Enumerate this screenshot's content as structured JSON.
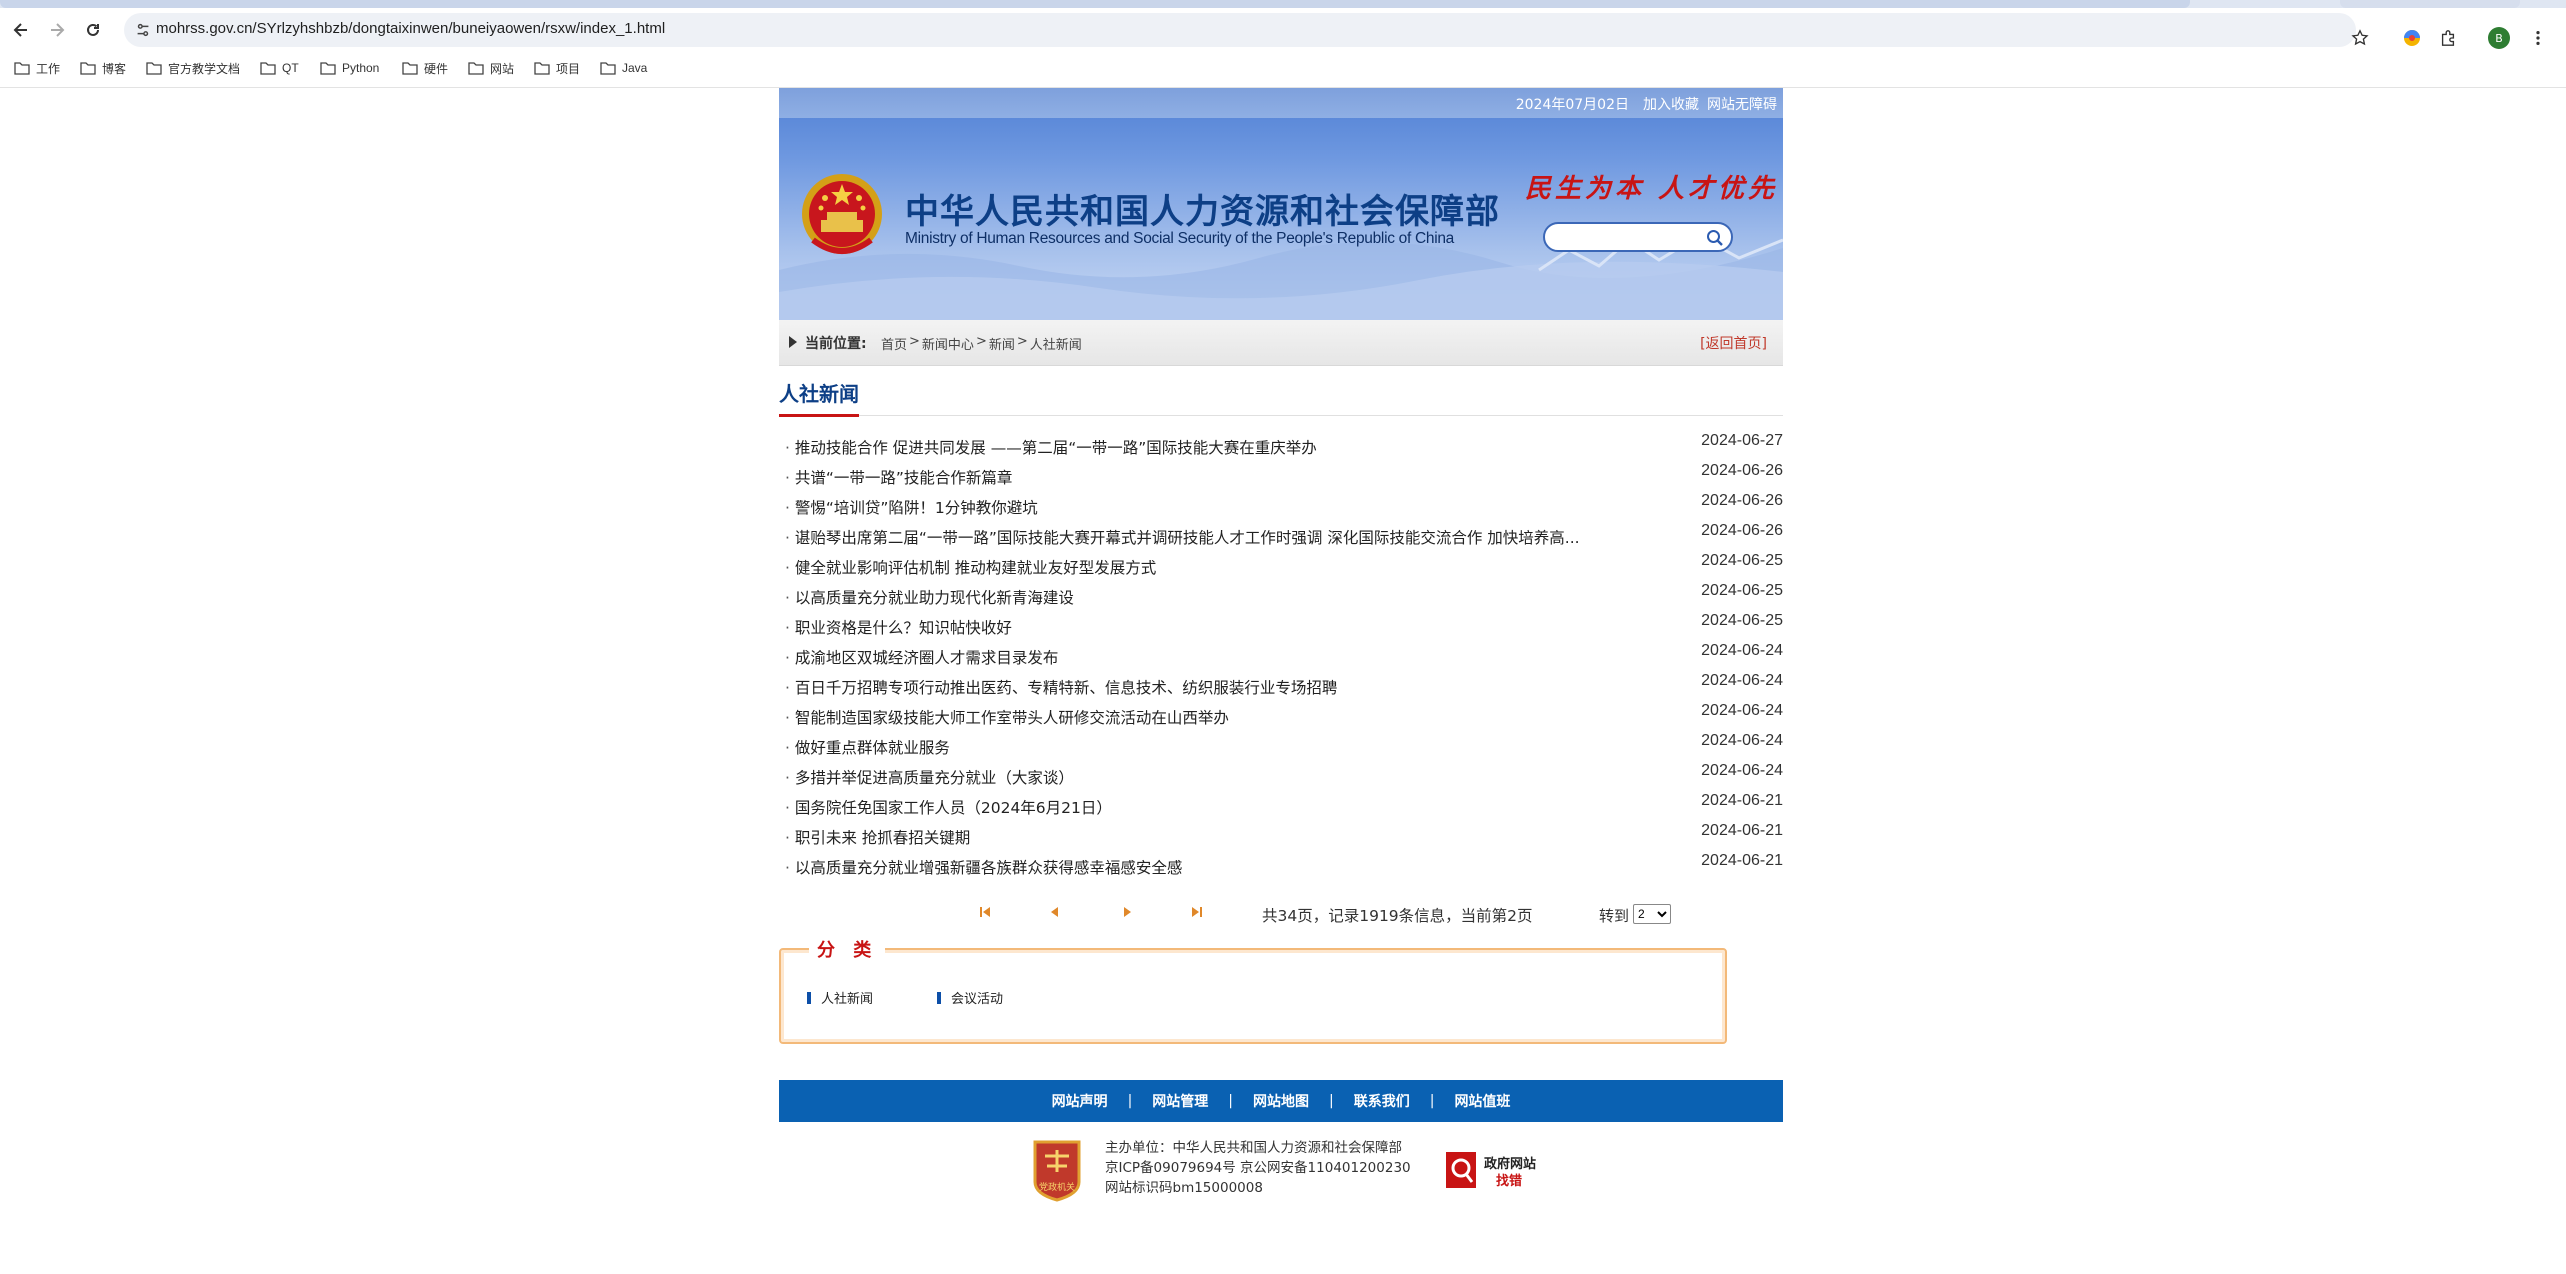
{
  "browser": {
    "url": "mohrss.gov.cn/SYrlzyhshbzb/dongtaixinwen/buneiyaowen/rsxw/index_1.html",
    "profile_initial": "B",
    "bookmarks": [
      "工作",
      "博客",
      "官方教学文档",
      "QT",
      "Python",
      "硬件",
      "网站",
      "项目",
      "Java"
    ]
  },
  "header": {
    "date": "2024年07月02日",
    "add_favorite": "加入收藏",
    "accessibility": "网站无障碍",
    "title_cn": "中华人民共和国人力资源和社会保障部",
    "title_en": "Ministry of Human Resources and Social Security of the People's Republic of China",
    "slogan": "民生为本 人才优先",
    "search_placeholder": ""
  },
  "breadcrumb": {
    "label": "当前位置:",
    "items": [
      "首页",
      "新闻中心",
      "新闻",
      "人社新闻"
    ],
    "separator": ">",
    "back_home": "[返回首页]"
  },
  "section": {
    "title": "人社新闻"
  },
  "news": [
    {
      "title": "推动技能合作 促进共同发展 ——第二届“一带一路”国际技能大赛在重庆举办",
      "date": "2024-06-27"
    },
    {
      "title": "共谱“一带一路”技能合作新篇章",
      "date": "2024-06-26"
    },
    {
      "title": "警惕“培训贷”陷阱！1分钟教你避坑",
      "date": "2024-06-26"
    },
    {
      "title": "谌贻琴出席第二届“一带一路”国际技能大赛开幕式并调研技能人才工作时强调 深化国际技能交流合作 加快培养高...",
      "date": "2024-06-26"
    },
    {
      "title": "健全就业影响评估机制 推动构建就业友好型发展方式",
      "date": "2024-06-25"
    },
    {
      "title": "以高质量充分就业助力现代化新青海建设",
      "date": "2024-06-25"
    },
    {
      "title": "职业资格是什么？知识帖快收好",
      "date": "2024-06-25"
    },
    {
      "title": "成渝地区双城经济圈人才需求目录发布",
      "date": "2024-06-24"
    },
    {
      "title": "百日千万招聘专项行动推出医药、专精特新、信息技术、纺织服装行业专场招聘",
      "date": "2024-06-24"
    },
    {
      "title": "智能制造国家级技能大师工作室带头人研修交流活动在山西举办",
      "date": "2024-06-24"
    },
    {
      "title": "做好重点群体就业服务",
      "date": "2024-06-24"
    },
    {
      "title": "多措并举促进高质量充分就业（大家谈）",
      "date": "2024-06-24"
    },
    {
      "title": "国务院任免国家工作人员（2024年6月21日）",
      "date": "2024-06-21"
    },
    {
      "title": "职引未来 抢抓春招关键期",
      "date": "2024-06-21"
    },
    {
      "title": "以高质量充分就业增强新疆各族群众获得感幸福感安全感",
      "date": "2024-06-21"
    }
  ],
  "pager": {
    "info": "共34页，记录1919条信息，当前第2页",
    "goto_label": "转到",
    "current": "2"
  },
  "category": {
    "title": "分 类",
    "items": [
      "人社新闻",
      "会议活动"
    ]
  },
  "footer": {
    "nav": [
      "网站声明",
      "网站管理",
      "网站地图",
      "联系我们",
      "网站值班"
    ],
    "host": "主办单位：中华人民共和国人力资源和社会保障部",
    "icp": "京ICP备09079694号 京公网安备110401200230",
    "site_code": "网站标识码bm15000008",
    "gov_badge_line1": "政府网站",
    "gov_badge_line2": "找错",
    "party_badge_text": "党政机关"
  },
  "colors": {
    "brand_blue": "#0d3f86",
    "accent_red": "#c81414",
    "footer_blue": "#0a61b2"
  }
}
